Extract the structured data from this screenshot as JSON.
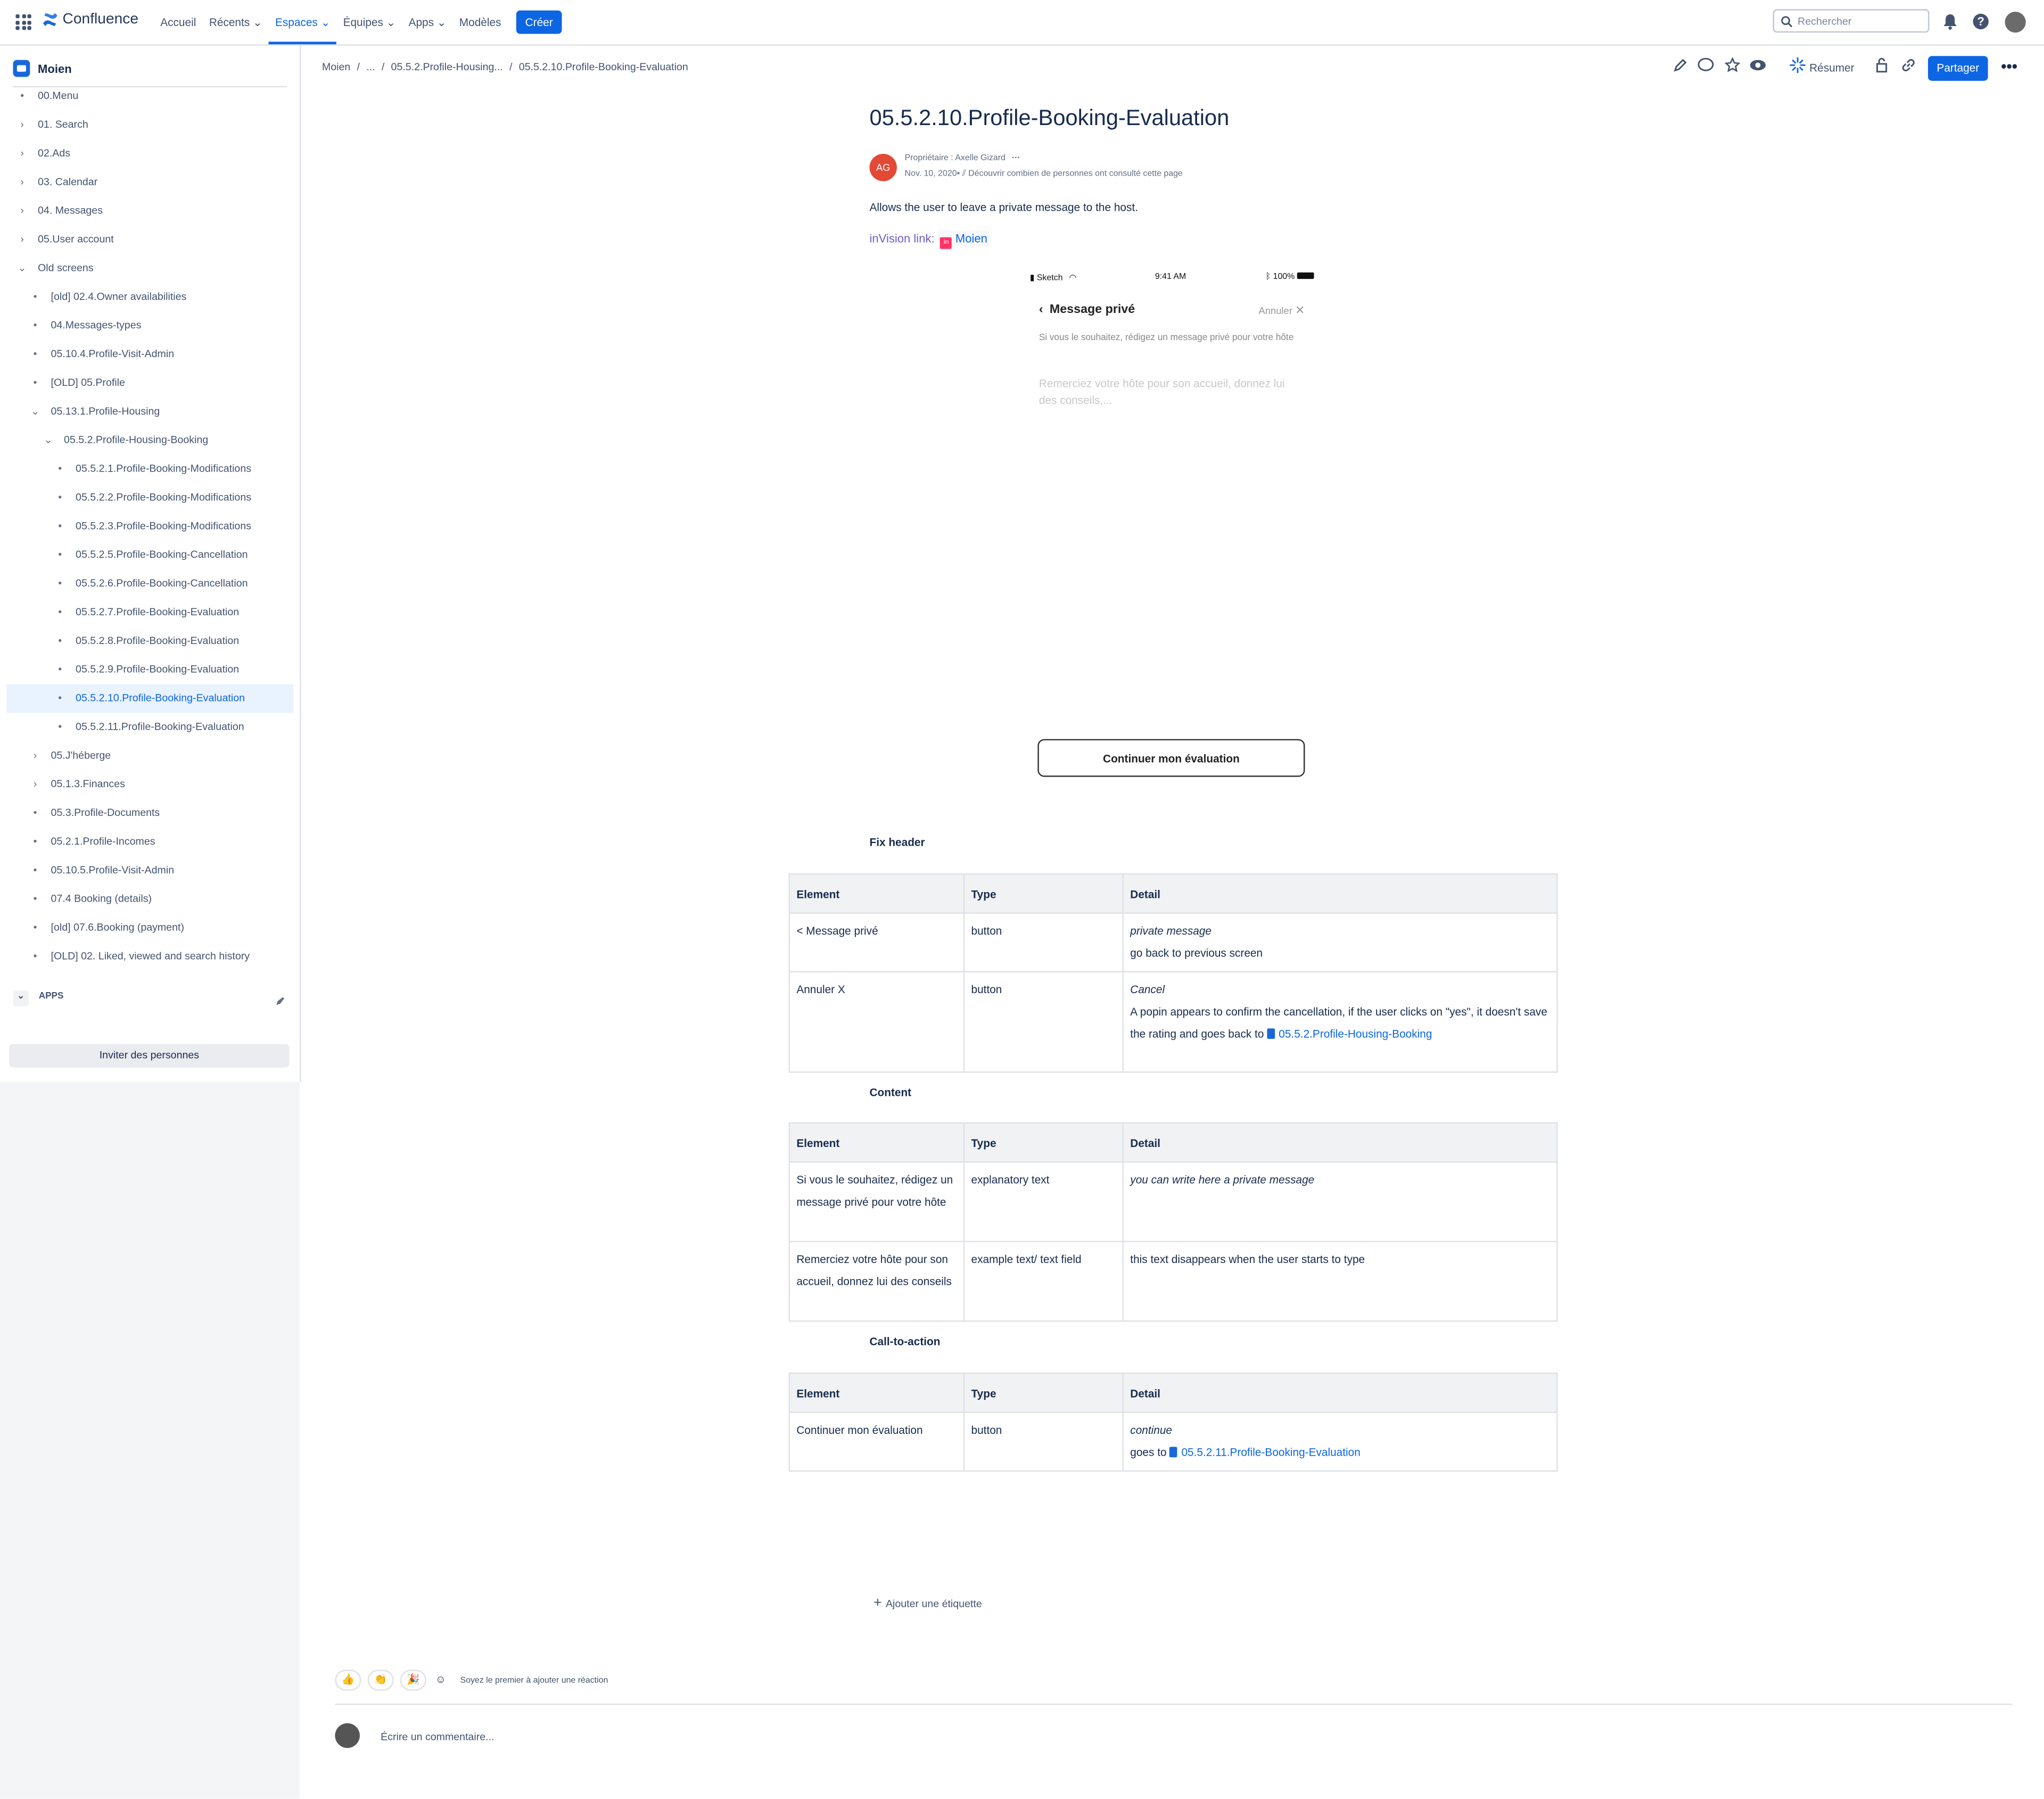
{
  "topbar": {
    "brand": "Confluence",
    "nav": [
      "Accueil",
      "Récents",
      "Espaces",
      "Équipes",
      "Apps",
      "Modèles"
    ],
    "create": "Créer",
    "search_placeholder": "Rechercher"
  },
  "sidebar": {
    "space_name": "Moien",
    "tree": [
      {
        "label": "00.Menu",
        "level": 1,
        "mark": "•"
      },
      {
        "label": "01. Search",
        "level": 1,
        "mark": "›"
      },
      {
        "label": "02.Ads",
        "level": 1,
        "mark": "›"
      },
      {
        "label": "03. Calendar",
        "level": 1,
        "mark": "›"
      },
      {
        "label": "04. Messages",
        "level": 1,
        "mark": "›"
      },
      {
        "label": "05.User account",
        "level": 1,
        "mark": "›"
      },
      {
        "label": "Old screens",
        "level": 1,
        "mark": "⌄"
      },
      {
        "label": "[old] 02.4.Owner availabilities",
        "level": 2,
        "mark": "•"
      },
      {
        "label": "04.Messages-types",
        "level": 2,
        "mark": "•"
      },
      {
        "label": "05.10.4.Profile-Visit-Admin",
        "level": 2,
        "mark": "•"
      },
      {
        "label": "[OLD] 05.Profile",
        "level": 2,
        "mark": "•"
      },
      {
        "label": "05.13.1.Profile-Housing",
        "level": 2,
        "mark": "⌄"
      },
      {
        "label": "05.5.2.Profile-Housing-Booking",
        "level": 3,
        "mark": "⌄"
      },
      {
        "label": "05.5.2.1.Profile-Booking-Modifications",
        "level": 4,
        "mark": "•"
      },
      {
        "label": "05.5.2.2.Profile-Booking-Modifications",
        "level": 4,
        "mark": "•"
      },
      {
        "label": "05.5.2.3.Profile-Booking-Modifications",
        "level": 4,
        "mark": "•"
      },
      {
        "label": "05.5.2.5.Profile-Booking-Cancellation",
        "level": 4,
        "mark": "•"
      },
      {
        "label": "05.5.2.6.Profile-Booking-Cancellation",
        "level": 4,
        "mark": "•"
      },
      {
        "label": "05.5.2.7.Profile-Booking-Evaluation",
        "level": 4,
        "mark": "•"
      },
      {
        "label": "05.5.2.8.Profile-Booking-Evaluation",
        "level": 4,
        "mark": "•"
      },
      {
        "label": "05.5.2.9.Profile-Booking-Evaluation",
        "level": 4,
        "mark": "•"
      },
      {
        "label": "05.5.2.10.Profile-Booking-Evaluation",
        "level": 4,
        "mark": "•",
        "selected": true
      },
      {
        "label": "05.5.2.11.Profile-Booking-Evaluation",
        "level": 4,
        "mark": "•"
      },
      {
        "label": "05.J'héberge",
        "level": 2,
        "mark": "›"
      },
      {
        "label": "05.1.3.Finances",
        "level": 2,
        "mark": "›"
      },
      {
        "label": "05.3.Profile-Documents",
        "level": 2,
        "mark": "•"
      },
      {
        "label": "05.2.1.Profile-Incomes",
        "level": 2,
        "mark": "•"
      },
      {
        "label": "05.10.5.Profile-Visit-Admin",
        "level": 2,
        "mark": "•"
      },
      {
        "label": "07.4 Booking (details)",
        "level": 2,
        "mark": "•"
      },
      {
        "label": "[old] 07.6.Booking (payment)",
        "level": 2,
        "mark": "•"
      },
      {
        "label": "[OLD] 02. Liked, viewed and search history",
        "level": 2,
        "mark": "•"
      }
    ],
    "apps_heading": "APPS",
    "invite": "Inviter des personnes"
  },
  "breadcrumb": [
    "Moien",
    "...",
    "05.5.2.Profile-Housing...",
    "05.5.2.10.Profile-Booking-Evaluation"
  ],
  "page": {
    "resume": "Résumer",
    "share": "Partager",
    "title": "05.5.2.10.Profile-Booking-Evaluation",
    "avatar_initials": "AG",
    "owner": "Propriétaire : Axelle Gizard",
    "date": "Nov. 10, 2020",
    "analytics": "Découvrir combien de personnes ont consulté cette page",
    "description": "Allows the user to leave a private message to the host.",
    "invision_label": "inVision link",
    "invision_link": "Moien"
  },
  "phone": {
    "carrier": "Sketch",
    "time": "9:41 AM",
    "battery": "100%",
    "title": "Message privé",
    "cancel": "Annuler",
    "help": "Si vous le souhaitez, rédigez un message privé pour votre hôte",
    "placeholder": "Remerciez votre hôte pour son accueil, donnez lui des conseils,...",
    "cta": "Continuer mon évaluation"
  },
  "sections": {
    "fix_header": "Fix header",
    "content": "Content",
    "cta": "Call-to-action"
  },
  "table_headers": [
    "Element",
    "Type",
    "Detail"
  ],
  "fix_header_rows": [
    {
      "element": "< Message privé",
      "type": "button",
      "detail_italic": "private message",
      "detail": "go back to previous screen"
    },
    {
      "element": "Annuler X",
      "type": "button",
      "detail_italic": "Cancel",
      "detail": "A popin appears to confirm the cancellation, if the user clicks on \"yes\", it doesn't save the rating and goes back to",
      "link": "05.5.2.Profile-Housing-Booking"
    }
  ],
  "content_rows": [
    {
      "element": "Si vous le souhaitez, rédigez un message privé pour votre hôte",
      "type": "explanatory text",
      "detail_italic": "you can write here a private message"
    },
    {
      "element": "Remerciez votre hôte pour son accueil, donnez lui des conseils",
      "type": "example text/ text field",
      "detail": "this text disappears when the user starts to type"
    }
  ],
  "cta_rows": [
    {
      "element": "Continuer mon évaluation",
      "type": "button",
      "detail_italic": "continue",
      "detail_prefix": "goes to",
      "link": "05.5.2.11.Profile-Booking-Evaluation"
    }
  ],
  "footer": {
    "add_label": "Ajouter une étiquette",
    "reaction_prompt": "Soyez le premier à ajouter une réaction",
    "comment_placeholder": "Écrire un commentaire..."
  }
}
